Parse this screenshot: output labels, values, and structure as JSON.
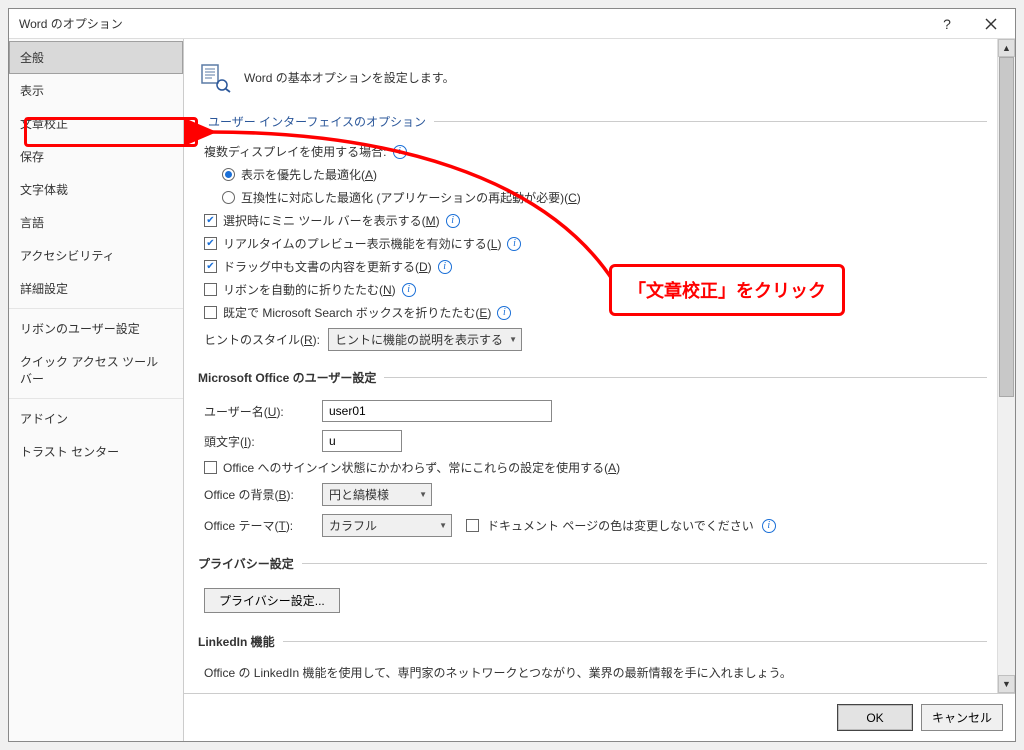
{
  "window": {
    "title": "Word のオプション"
  },
  "sidebar": {
    "items": [
      {
        "label": "全般",
        "selected": true
      },
      {
        "label": "表示"
      },
      {
        "label": "文章校正"
      },
      {
        "label": "保存"
      },
      {
        "label": "文字体裁"
      },
      {
        "label": "言語"
      },
      {
        "label": "アクセシビリティ"
      },
      {
        "label": "詳細設定"
      },
      {
        "sep": true
      },
      {
        "label": "リボンのユーザー設定"
      },
      {
        "label": "クイック アクセス ツール バー"
      },
      {
        "sep": true
      },
      {
        "label": "アドイン"
      },
      {
        "label": "トラスト センター"
      }
    ]
  },
  "header_text": "Word の基本オプションを設定します。",
  "sec_ui": {
    "title_truncated": "ユーザー インターフェイスのオプション",
    "multi_disp_label": "複数ディスプレイを使用する場合:",
    "radio_a": "表示を優先した最適化(",
    "radio_a_key": "A",
    "radio_a_end": ")",
    "radio_c": "互換性に対応した最適化 (アプリケーションの再起動が必要)(",
    "radio_c_key": "C",
    "radio_c_end": ")",
    "chk_m": "選択時にミニ ツール バーを表示する(",
    "chk_m_key": "M",
    "chk_m_end": ")",
    "chk_l": "リアルタイムのプレビュー表示機能を有効にする(",
    "chk_l_key": "L",
    "chk_l_end": ")",
    "chk_d": "ドラッグ中も文書の内容を更新する(",
    "chk_d_key": "D",
    "chk_d_end": ")",
    "chk_n": "リボンを自動的に折りたたむ(",
    "chk_n_key": "N",
    "chk_n_end": ")",
    "chk_e": "既定で Microsoft Search ボックスを折りたたむ(",
    "chk_e_key": "E",
    "chk_e_end": ")",
    "hint_label_pre": "ヒントのスタイル(",
    "hint_label_key": "R",
    "hint_label_post": "):",
    "hint_value": "ヒントに機能の説明を表示する"
  },
  "sec_user": {
    "title": "Microsoft Office のユーザー設定",
    "username_label_pre": "ユーザー名(",
    "username_label_key": "U",
    "username_label_post": "):",
    "username_value": "user01",
    "initials_label_pre": "頭文字(",
    "initials_label_key": "I",
    "initials_label_post": "):",
    "initials_value": "u",
    "always_use": "Office へのサインイン状態にかかわらず、常にこれらの設定を使用する(",
    "always_use_key": "A",
    "always_use_end": ")",
    "bg_label_pre": "Office の背景(",
    "bg_label_key": "B",
    "bg_label_post": "):",
    "bg_value": "円と縞模様",
    "theme_label_pre": "Office テーマ(",
    "theme_label_key": "T",
    "theme_label_post": "):",
    "theme_value": "カラフル",
    "doc_color": "ドキュメント ページの色は変更しないでください"
  },
  "sec_privacy": {
    "title": "プライバシー設定",
    "btn": "プライバシー設定..."
  },
  "sec_linkedin": {
    "title": "LinkedIn 機能",
    "desc": "Office の LinkedIn 機能を使用して、専門家のネットワークとつながり、業界の最新情報を手に入れましょう。"
  },
  "buttons": {
    "ok": "OK",
    "cancel": "キャンセル"
  },
  "annotation": {
    "text": "「文章校正」をクリック"
  }
}
